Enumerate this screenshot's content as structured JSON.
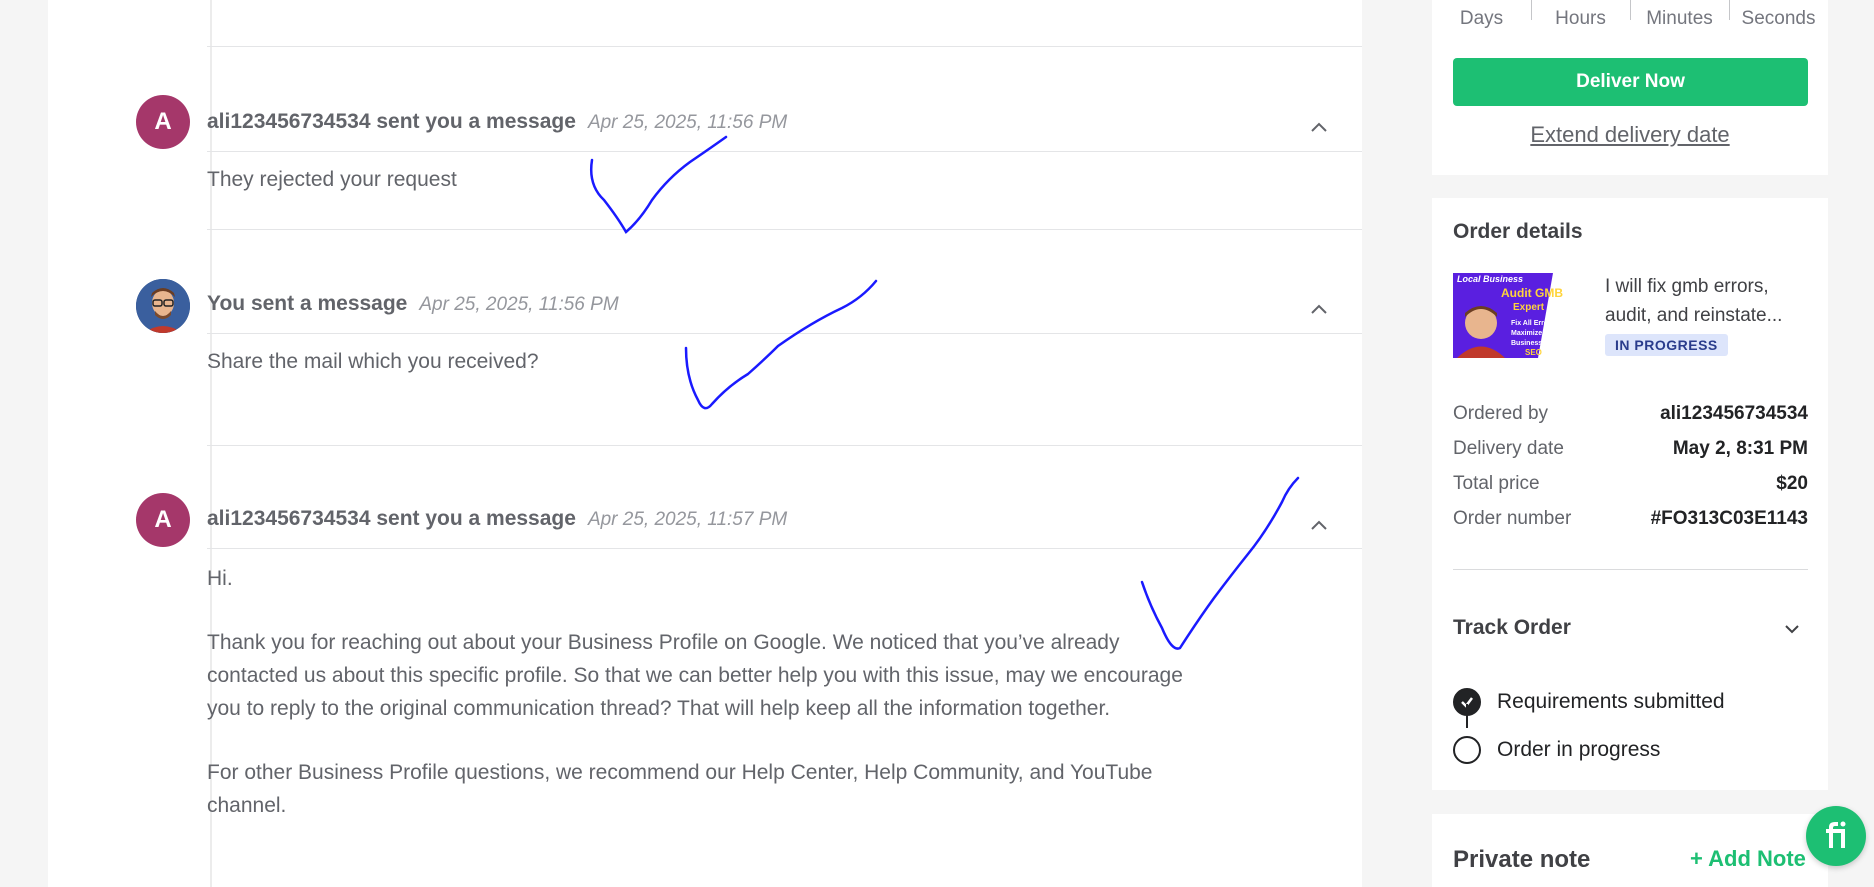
{
  "messages": [
    {
      "avatar_letter": "A",
      "sender": "ali123456734534 sent you a message",
      "time": "Apr 25, 2025, 11:56 PM",
      "body": [
        "They rejected your request"
      ]
    },
    {
      "avatar_letter": "",
      "sender": "You sent a message",
      "time": "Apr 25, 2025, 11:56 PM",
      "body": [
        "Share the mail which you received?"
      ]
    },
    {
      "avatar_letter": "A",
      "sender": "ali123456734534 sent you a message",
      "time": "Apr 25, 2025, 11:57 PM",
      "body": [
        "Hi.",
        "Thank you for reaching out about your Business Profile on Google. We noticed that you’ve already contacted us about this specific profile. So that we can better help you with this issue, may we encourage you to reply to the original communication thread? That will help keep all the information together.",
        "For other Business Profile questions, we recommend our Help Center, Help Community, and YouTube channel."
      ]
    }
  ],
  "countdown": {
    "labels": [
      "Days",
      "Hours",
      "Minutes",
      "Seconds"
    ],
    "deliver_label": "Deliver Now",
    "extend_label": "Extend delivery date"
  },
  "order": {
    "title": "Order details",
    "gig_title": "I will fix gmb errors, audit, and reinstate...",
    "status": "IN PROGRESS",
    "thumbnail_text": {
      "line1": "Local Business",
      "line2": "Audit GMB",
      "line3": "Expert",
      "bullets": [
        "Fix All Errors",
        "Maximize Reach",
        "Business on Track"
      ],
      "seo": "SEO"
    },
    "rows": [
      {
        "label": "Ordered by",
        "value": "ali123456734534"
      },
      {
        "label": "Delivery date",
        "value": "May 2, 8:31 PM"
      },
      {
        "label": "Total price",
        "value": "$20"
      },
      {
        "label": "Order number",
        "value": "#FO313C03E1143"
      }
    ],
    "track_title": "Track Order",
    "steps": [
      {
        "label": "Requirements submitted",
        "done": true
      },
      {
        "label": "Order in progress",
        "done": false
      }
    ]
  },
  "note": {
    "title": "Private note",
    "add_label": "+ Add Note"
  },
  "colors": {
    "accent": "#1dbf73",
    "avatar": "#a5376a",
    "badge_bg": "#dde5fb",
    "annotation_ink": "#1a1aff"
  }
}
